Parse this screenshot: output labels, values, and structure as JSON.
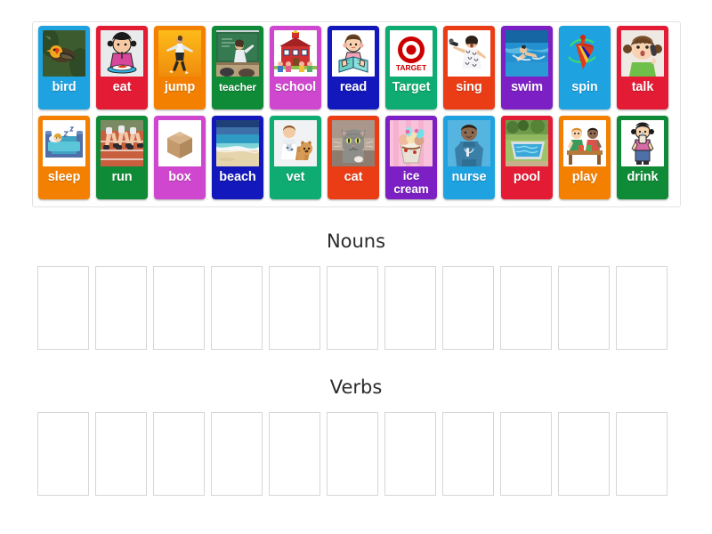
{
  "activity": {
    "type": "word-sort-drag-and-drop",
    "tile_bank": {
      "rows": [
        [
          {
            "label": "bird",
            "color": "#1ea2e0",
            "icon": "bird-photo-icon"
          },
          {
            "label": "eat",
            "color": "#e31b34",
            "icon": "eating-child-icon"
          },
          {
            "label": "jump",
            "color": "#f38000",
            "icon": "jumping-person-icon"
          },
          {
            "label": "teacher",
            "color": "#0f8a36",
            "icon": "teacher-chalkboard-icon",
            "size": "small"
          },
          {
            "label": "school",
            "color": "#cf47cf",
            "icon": "schoolhouse-icon"
          },
          {
            "label": "read",
            "color": "#1218bb",
            "icon": "reading-child-icon"
          },
          {
            "label": "Target",
            "color": "#0eab72",
            "icon": "target-logo-icon"
          },
          {
            "label": "sing",
            "color": "#ea3c15",
            "icon": "singing-woman-icon"
          },
          {
            "label": "swim",
            "color": "#7c1fc4",
            "icon": "swimmer-icon"
          },
          {
            "label": "spin",
            "color": "#1ea2e0",
            "icon": "spinning-top-icon"
          },
          {
            "label": "talk",
            "color": "#e31b34",
            "icon": "girl-phone-icon"
          }
        ],
        [
          {
            "label": "sleep",
            "color": "#f38000",
            "icon": "sleeping-bed-icon"
          },
          {
            "label": "run",
            "color": "#0f8a36",
            "icon": "runners-track-icon"
          },
          {
            "label": "box",
            "color": "#cf47cf",
            "icon": "cardboard-box-icon"
          },
          {
            "label": "beach",
            "color": "#1218bb",
            "icon": "beach-photo-icon"
          },
          {
            "label": "vet",
            "color": "#0eab72",
            "icon": "veterinarian-dog-icon"
          },
          {
            "label": "cat",
            "color": "#ea3c15",
            "icon": "cat-photo-icon"
          },
          {
            "label": "ice cream",
            "color": "#7c1fc4",
            "icon": "ice-cream-sundae-icon",
            "size": "two-line",
            "line1": "ice",
            "line2": "cream"
          },
          {
            "label": "nurse",
            "color": "#1ea2e0",
            "icon": "nurse-icon"
          },
          {
            "label": "pool",
            "color": "#e31b34",
            "icon": "swimming-pool-icon"
          },
          {
            "label": "play",
            "color": "#f38000",
            "icon": "children-playing-icon"
          },
          {
            "label": "drink",
            "color": "#0f8a36",
            "icon": "drinking-child-icon"
          }
        ]
      ]
    },
    "categories": [
      {
        "title": "Nouns",
        "slot_count": 11
      },
      {
        "title": "Verbs",
        "slot_count": 11
      }
    ]
  }
}
